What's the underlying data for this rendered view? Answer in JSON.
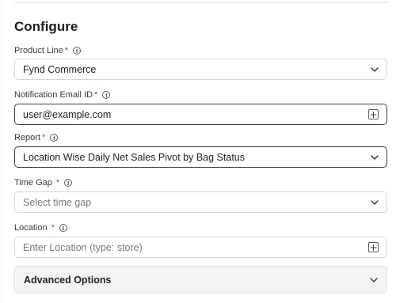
{
  "form": {
    "title": "Configure",
    "product_line": {
      "label": "Product Line",
      "required_mark": "*",
      "value": "Fynd Commerce"
    },
    "notification_email": {
      "label": "Notification Email ID",
      "required_mark": "*",
      "value": "user@example.com"
    },
    "report": {
      "label": "Report",
      "required_mark": "*",
      "value": "Location Wise Daily Net Sales Pivot by Bag Status"
    },
    "time_gap": {
      "label": "Time Gap",
      "required_mark": "*",
      "placeholder": "Select time gap"
    },
    "location": {
      "label": "Location",
      "required_mark": "*",
      "placeholder": "Enter Location (type: store)"
    },
    "advanced_options": {
      "label": "Advanced Options"
    }
  },
  "icons": {
    "info": "info-icon",
    "chevron": "chevron-down-icon",
    "add": "plus-icon"
  },
  "colors": {
    "required": "#d2314b",
    "focused_border": "#3a3a3a",
    "border": "#d6d6d6",
    "advanced_bg": "#f4f4f4"
  }
}
